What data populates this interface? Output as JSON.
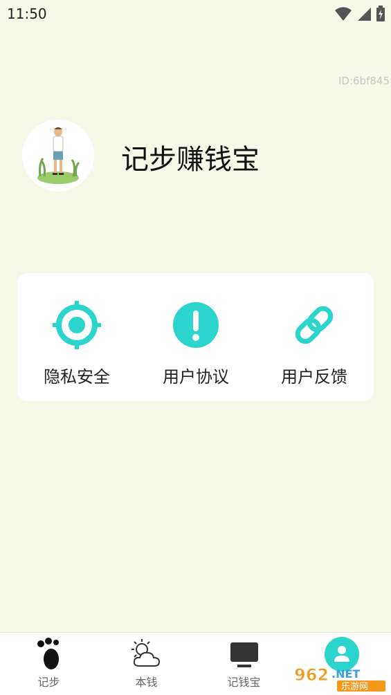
{
  "status_bar": {
    "time": "11:50"
  },
  "profile": {
    "user_id": "ID:6bf845",
    "app_title": "记步赚钱宝"
  },
  "menu": [
    {
      "label": "隐私安全",
      "icon": "crosshair-icon"
    },
    {
      "label": "用户协议",
      "icon": "exclamation-icon"
    },
    {
      "label": "用户反馈",
      "icon": "link-icon"
    }
  ],
  "tabs": [
    {
      "label": "记步",
      "icon": "footprint-icon"
    },
    {
      "label": "本钱",
      "icon": "sun-cloud-icon"
    },
    {
      "label": "记钱宝",
      "icon": "tv-icon"
    },
    {
      "label": "",
      "icon": "user-icon"
    }
  ],
  "watermark": {
    "logo": "962.NET",
    "text": "乐游网"
  },
  "colors": {
    "accent": "#2bd4cc",
    "background": "#f6f8e8"
  }
}
